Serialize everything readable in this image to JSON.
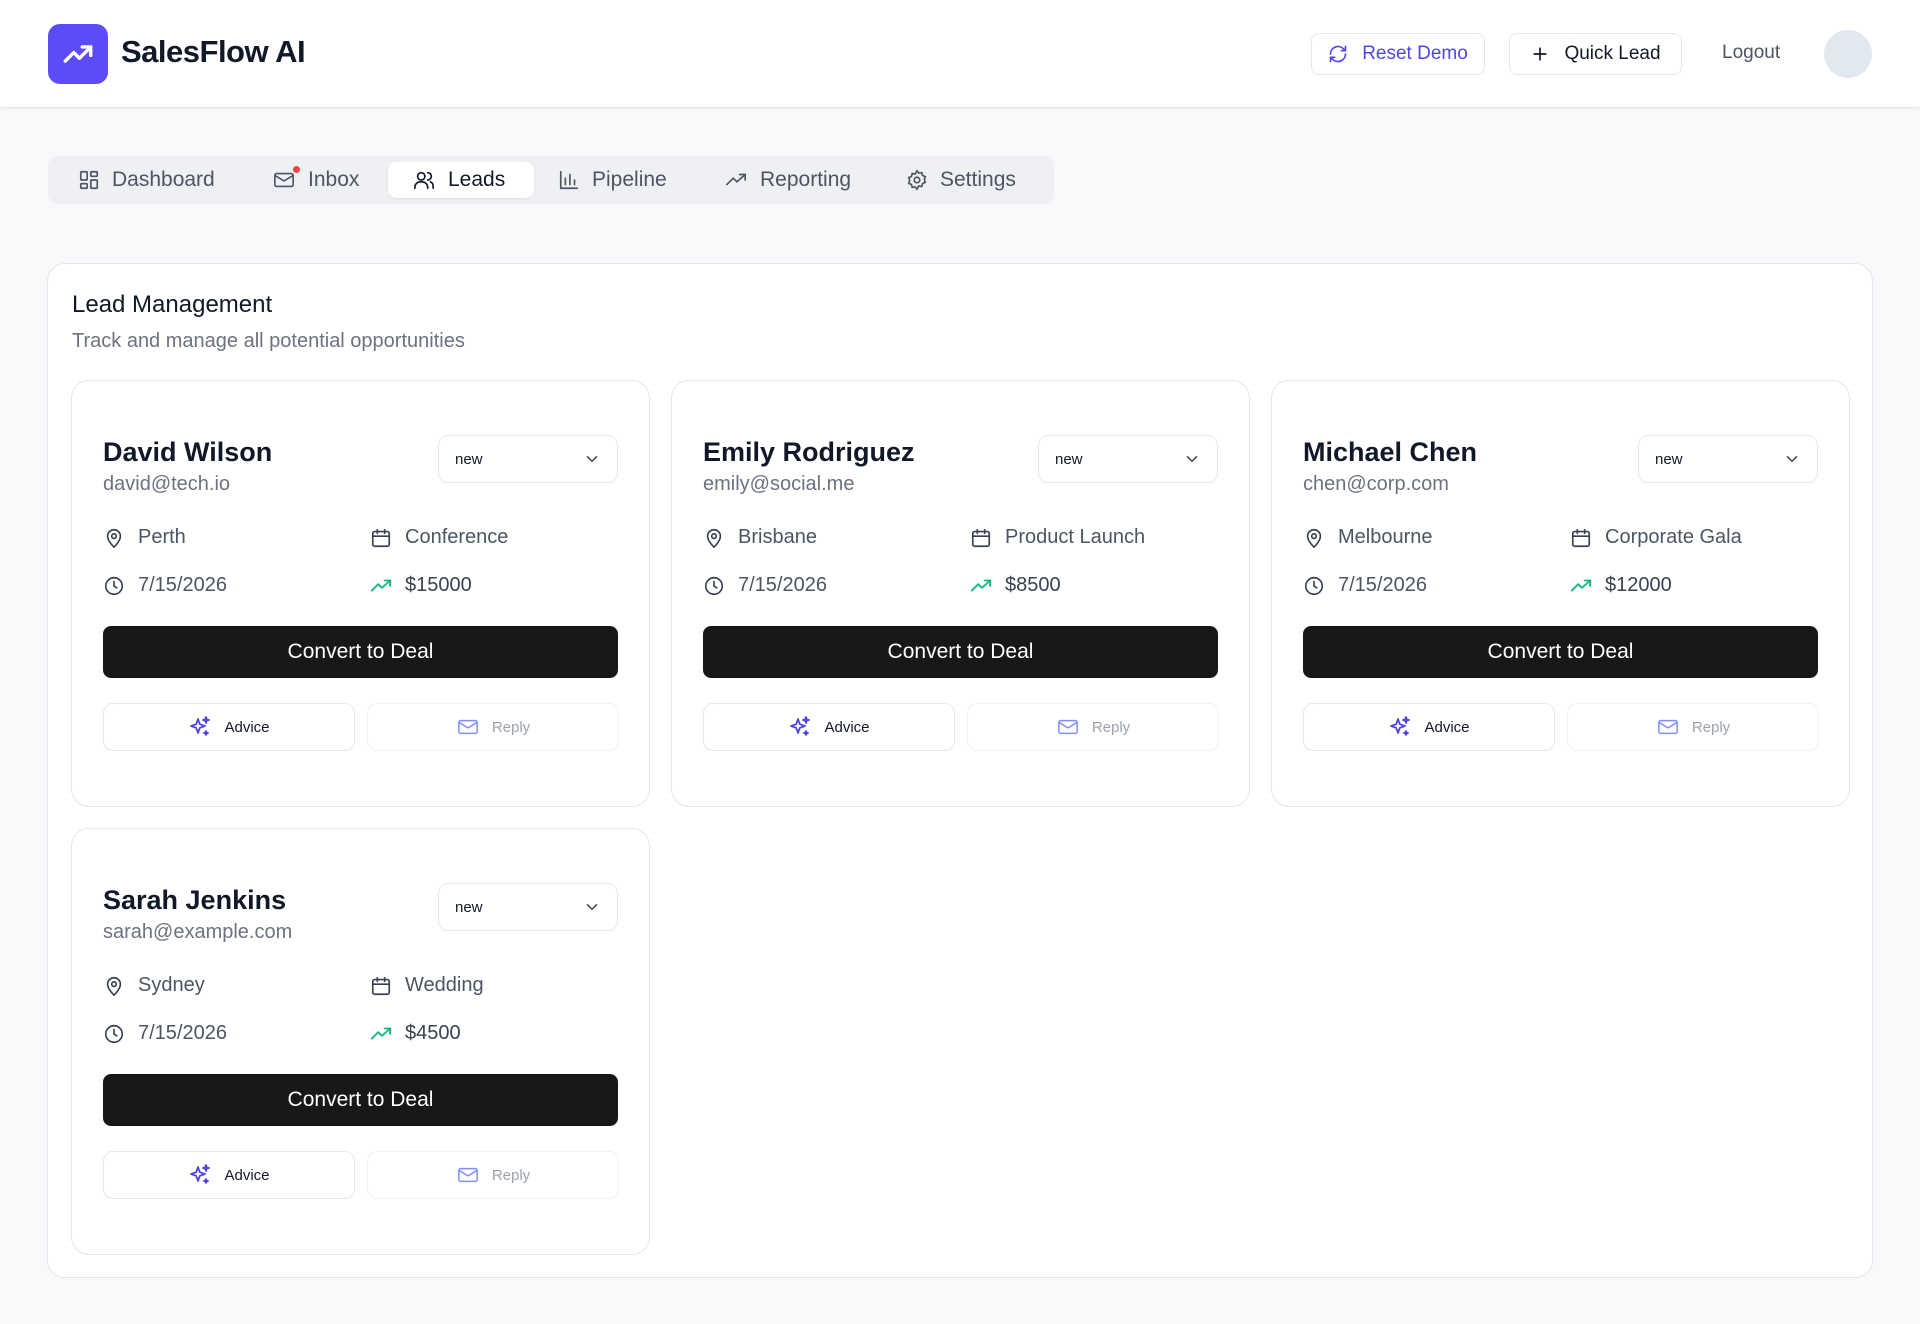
{
  "app": {
    "title": "SalesFlow AI",
    "brand_color": "#5b4cf5",
    "logo_icon": "trending-up-icon"
  },
  "header": {
    "reset_label": "Reset Demo",
    "quick_lead_label": "Quick Lead",
    "logout_label": "Logout"
  },
  "tabs": [
    {
      "label": "Dashboard",
      "icon": "dashboard-grid-icon",
      "active": false
    },
    {
      "label": "Inbox",
      "icon": "mail-icon",
      "active": false,
      "has_notification": true
    },
    {
      "label": "Leads",
      "icon": "users-icon",
      "active": true
    },
    {
      "label": "Pipeline",
      "icon": "bar-chart-icon",
      "active": false
    },
    {
      "label": "Reporting",
      "icon": "trending-up-icon",
      "active": false
    },
    {
      "label": "Settings",
      "icon": "gear-icon",
      "active": false
    }
  ],
  "panel": {
    "title": "Lead Management",
    "subtitle": "Track and manage all potential opportunities"
  },
  "leads": [
    {
      "name": "David Wilson",
      "email": "david@tech.io",
      "status": "new",
      "location": "Perth",
      "event": "Conference",
      "date": "7/15/2026",
      "value": "$15000",
      "convert_label": "Convert to Deal",
      "advice_label": "Advice",
      "reply_label": "Reply"
    },
    {
      "name": "Emily Rodriguez",
      "email": "emily@social.me",
      "status": "new",
      "location": "Brisbane",
      "event": "Product Launch",
      "date": "7/15/2026",
      "value": "$8500",
      "convert_label": "Convert to Deal",
      "advice_label": "Advice",
      "reply_label": "Reply"
    },
    {
      "name": "Michael Chen",
      "email": "chen@corp.com",
      "status": "new",
      "location": "Melbourne",
      "event": "Corporate Gala",
      "date": "7/15/2026",
      "value": "$12000",
      "convert_label": "Convert to Deal",
      "advice_label": "Advice",
      "reply_label": "Reply"
    },
    {
      "name": "Sarah Jenkins",
      "email": "sarah@example.com",
      "status": "new",
      "location": "Sydney",
      "event": "Wedding",
      "date": "7/15/2026",
      "value": "$4500",
      "convert_label": "Convert to Deal",
      "advice_label": "Advice",
      "reply_label": "Reply"
    }
  ],
  "colors": {
    "accent": "#4f46e5",
    "value_trend": "#10b981",
    "primary_button": "#18181b",
    "notification": "#ef4444"
  }
}
